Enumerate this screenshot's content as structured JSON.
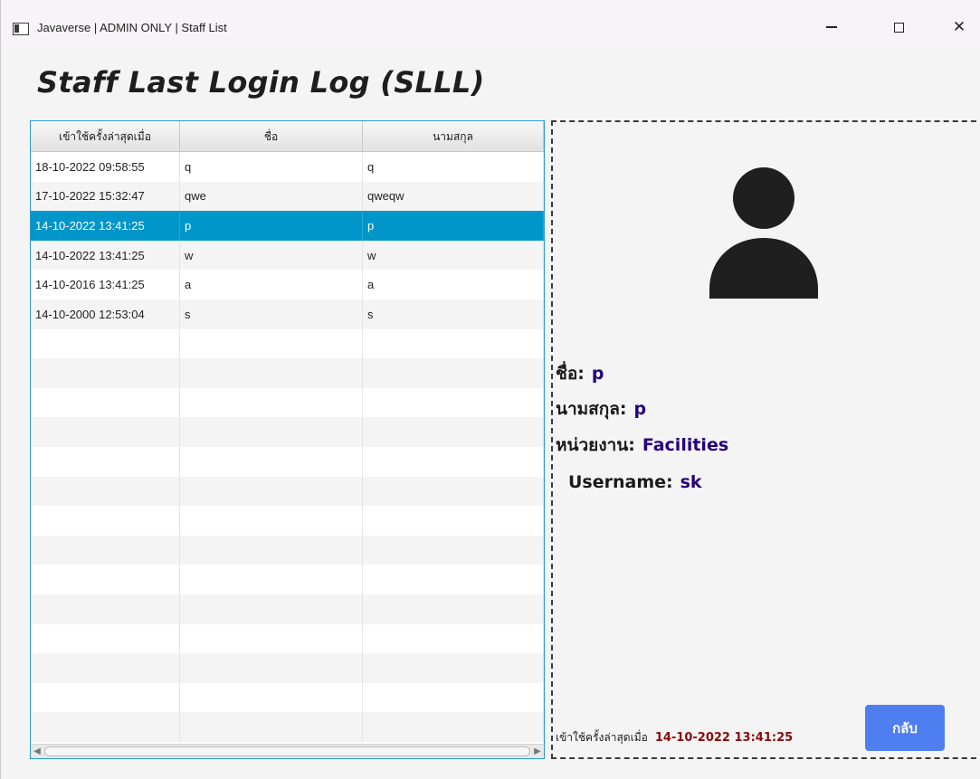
{
  "window": {
    "title": "Javaverse | ADMIN ONLY | Staff List",
    "minimize": "—",
    "close": "✕"
  },
  "page": {
    "title": "Staff Last Login Log (SLLL)"
  },
  "table": {
    "columns": [
      "เข้าใช้ครั้งล่าสุดเมื่อ",
      "ชื่อ",
      "นามสกุล"
    ],
    "rows": [
      [
        "18-10-2022 09:58:55",
        "q",
        "q"
      ],
      [
        "17-10-2022 15:32:47",
        "qwe",
        "qweqw"
      ],
      [
        "14-10-2022 13:41:25",
        "p",
        "p"
      ],
      [
        "14-10-2022 13:41:25",
        "w",
        "w"
      ],
      [
        "14-10-2016 13:41:25",
        "a",
        "a"
      ],
      [
        "14-10-2000 12:53:04",
        "s",
        "s"
      ]
    ],
    "selected_row": 2,
    "empty_rows": 14
  },
  "detail": {
    "name_label": "ชื่อ:",
    "name_value": "p",
    "surname_label": "นามสกุล:",
    "surname_value": "p",
    "dept_label": "หน่วยงาน:",
    "dept_value": "Facilities",
    "username_label": "Username:",
    "username_value": "sk",
    "last_login_label": "เข้าใช้ครั้งล่าสุดเมื่อ",
    "last_login_value": "14-10-2022 13:41:25",
    "back_button": "กลับ"
  },
  "colors": {
    "selected_row": "#0096c9",
    "value_text": "#26007a",
    "last_login_value": "#8b0a0a",
    "back_button": "#4f7ef0"
  },
  "icons": [
    "app-window-icon",
    "user-avatar-icon"
  ]
}
